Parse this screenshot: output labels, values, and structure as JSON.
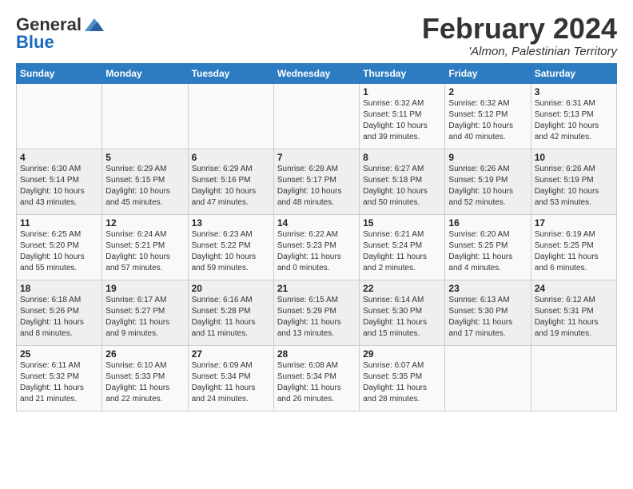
{
  "header": {
    "logo_general": "General",
    "logo_blue": "Blue",
    "month_title": "February 2024",
    "location": "'Almon, Palestinian Territory"
  },
  "days_of_week": [
    "Sunday",
    "Monday",
    "Tuesday",
    "Wednesday",
    "Thursday",
    "Friday",
    "Saturday"
  ],
  "weeks": [
    [
      {
        "day": "",
        "info": ""
      },
      {
        "day": "",
        "info": ""
      },
      {
        "day": "",
        "info": ""
      },
      {
        "day": "",
        "info": ""
      },
      {
        "day": "1",
        "info": "Sunrise: 6:32 AM\nSunset: 5:11 PM\nDaylight: 10 hours\nand 39 minutes."
      },
      {
        "day": "2",
        "info": "Sunrise: 6:32 AM\nSunset: 5:12 PM\nDaylight: 10 hours\nand 40 minutes."
      },
      {
        "day": "3",
        "info": "Sunrise: 6:31 AM\nSunset: 5:13 PM\nDaylight: 10 hours\nand 42 minutes."
      }
    ],
    [
      {
        "day": "4",
        "info": "Sunrise: 6:30 AM\nSunset: 5:14 PM\nDaylight: 10 hours\nand 43 minutes."
      },
      {
        "day": "5",
        "info": "Sunrise: 6:29 AM\nSunset: 5:15 PM\nDaylight: 10 hours\nand 45 minutes."
      },
      {
        "day": "6",
        "info": "Sunrise: 6:29 AM\nSunset: 5:16 PM\nDaylight: 10 hours\nand 47 minutes."
      },
      {
        "day": "7",
        "info": "Sunrise: 6:28 AM\nSunset: 5:17 PM\nDaylight: 10 hours\nand 48 minutes."
      },
      {
        "day": "8",
        "info": "Sunrise: 6:27 AM\nSunset: 5:18 PM\nDaylight: 10 hours\nand 50 minutes."
      },
      {
        "day": "9",
        "info": "Sunrise: 6:26 AM\nSunset: 5:19 PM\nDaylight: 10 hours\nand 52 minutes."
      },
      {
        "day": "10",
        "info": "Sunrise: 6:26 AM\nSunset: 5:19 PM\nDaylight: 10 hours\nand 53 minutes."
      }
    ],
    [
      {
        "day": "11",
        "info": "Sunrise: 6:25 AM\nSunset: 5:20 PM\nDaylight: 10 hours\nand 55 minutes."
      },
      {
        "day": "12",
        "info": "Sunrise: 6:24 AM\nSunset: 5:21 PM\nDaylight: 10 hours\nand 57 minutes."
      },
      {
        "day": "13",
        "info": "Sunrise: 6:23 AM\nSunset: 5:22 PM\nDaylight: 10 hours\nand 59 minutes."
      },
      {
        "day": "14",
        "info": "Sunrise: 6:22 AM\nSunset: 5:23 PM\nDaylight: 11 hours\nand 0 minutes."
      },
      {
        "day": "15",
        "info": "Sunrise: 6:21 AM\nSunset: 5:24 PM\nDaylight: 11 hours\nand 2 minutes."
      },
      {
        "day": "16",
        "info": "Sunrise: 6:20 AM\nSunset: 5:25 PM\nDaylight: 11 hours\nand 4 minutes."
      },
      {
        "day": "17",
        "info": "Sunrise: 6:19 AM\nSunset: 5:25 PM\nDaylight: 11 hours\nand 6 minutes."
      }
    ],
    [
      {
        "day": "18",
        "info": "Sunrise: 6:18 AM\nSunset: 5:26 PM\nDaylight: 11 hours\nand 8 minutes."
      },
      {
        "day": "19",
        "info": "Sunrise: 6:17 AM\nSunset: 5:27 PM\nDaylight: 11 hours\nand 9 minutes."
      },
      {
        "day": "20",
        "info": "Sunrise: 6:16 AM\nSunset: 5:28 PM\nDaylight: 11 hours\nand 11 minutes."
      },
      {
        "day": "21",
        "info": "Sunrise: 6:15 AM\nSunset: 5:29 PM\nDaylight: 11 hours\nand 13 minutes."
      },
      {
        "day": "22",
        "info": "Sunrise: 6:14 AM\nSunset: 5:30 PM\nDaylight: 11 hours\nand 15 minutes."
      },
      {
        "day": "23",
        "info": "Sunrise: 6:13 AM\nSunset: 5:30 PM\nDaylight: 11 hours\nand 17 minutes."
      },
      {
        "day": "24",
        "info": "Sunrise: 6:12 AM\nSunset: 5:31 PM\nDaylight: 11 hours\nand 19 minutes."
      }
    ],
    [
      {
        "day": "25",
        "info": "Sunrise: 6:11 AM\nSunset: 5:32 PM\nDaylight: 11 hours\nand 21 minutes."
      },
      {
        "day": "26",
        "info": "Sunrise: 6:10 AM\nSunset: 5:33 PM\nDaylight: 11 hours\nand 22 minutes."
      },
      {
        "day": "27",
        "info": "Sunrise: 6:09 AM\nSunset: 5:34 PM\nDaylight: 11 hours\nand 24 minutes."
      },
      {
        "day": "28",
        "info": "Sunrise: 6:08 AM\nSunset: 5:34 PM\nDaylight: 11 hours\nand 26 minutes."
      },
      {
        "day": "29",
        "info": "Sunrise: 6:07 AM\nSunset: 5:35 PM\nDaylight: 11 hours\nand 28 minutes."
      },
      {
        "day": "",
        "info": ""
      },
      {
        "day": "",
        "info": ""
      }
    ]
  ]
}
